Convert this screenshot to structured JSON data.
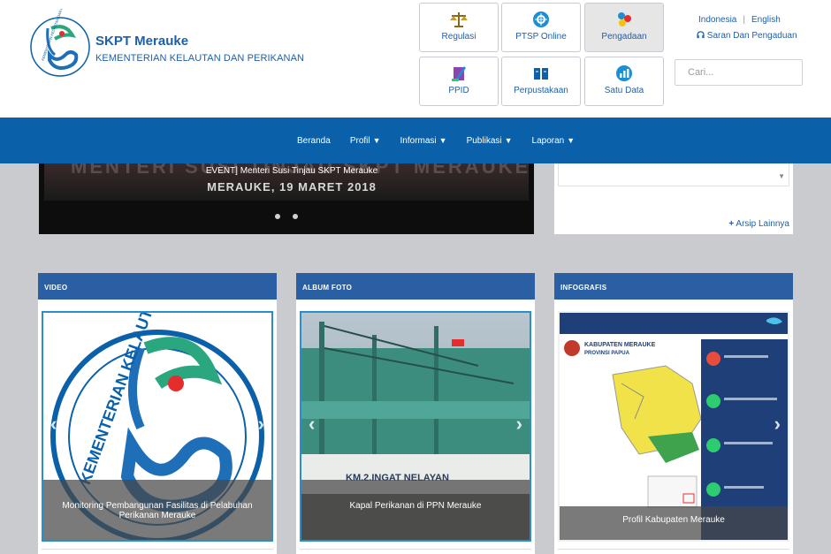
{
  "brand": {
    "title": "SKPT Merauke",
    "subtitle": "KEMENTERIAN KELAUTAN DAN PERIKANAN",
    "logo_text": "KEMENTERIAN KELAUTAN DAN PERIKANAN"
  },
  "tiles": [
    {
      "label": "Regulasi",
      "icon": "scales-icon"
    },
    {
      "label": "PTSP Online",
      "icon": "gear-icon"
    },
    {
      "label": "Pengadaan",
      "icon": "molecule-icon"
    },
    {
      "label": "PPID",
      "icon": "quill-icon"
    },
    {
      "label": "Perpustakaan",
      "icon": "book-icon"
    },
    {
      "label": "Satu Data",
      "icon": "chart-icon"
    }
  ],
  "lang": {
    "id": "Indonesia",
    "en": "English",
    "sep": "|"
  },
  "saran": "Saran Dan Pengaduan",
  "search": {
    "placeholder": "Cari..."
  },
  "nav": [
    {
      "label": "Beranda",
      "caret": ""
    },
    {
      "label": "Profil",
      "caret": "▼"
    },
    {
      "label": "Informasi",
      "caret": "▼"
    },
    {
      "label": "Publikasi",
      "caret": "▼"
    },
    {
      "label": "Laporan",
      "caret": "▼"
    }
  ],
  "slider": {
    "bg_text": "MENTERI SUSI TINJAU SKPT MERAUKE",
    "caption": "EVENT] Menteri Susi Tinjau SKPT Merauke",
    "date": "MERAUKE, 19 MARET 2018"
  },
  "arsip": {
    "link": "Arsip Lainnya",
    "scroll": "▼"
  },
  "cards": [
    {
      "title": "VIDEO",
      "caption": "Monitoring Pembangunan Fasilitas di Pelabuhan Perikanan Merauke",
      "ring_text": "KEMENTERIAN KELAUTAN DAN PERIKANAN"
    },
    {
      "title": "ALBUM FOTO",
      "caption": "Kapal Perikanan di PPN Merauke",
      "hull_text": "KM.2.INGAT NELAYAN"
    },
    {
      "title": "INFOGRAFIS",
      "caption": "Profil Kabupaten Merauke",
      "info_title": "KABUPATEN MERAUKE",
      "info_sub": "PROVINSI PAPUA"
    }
  ],
  "arrows": {
    "left": "‹",
    "right": "›"
  },
  "colors": {
    "nav": "#0a60a9",
    "card_head": "#2a5fa3",
    "brand": "#1e5fa8",
    "accent_red": "#e52d2d"
  }
}
